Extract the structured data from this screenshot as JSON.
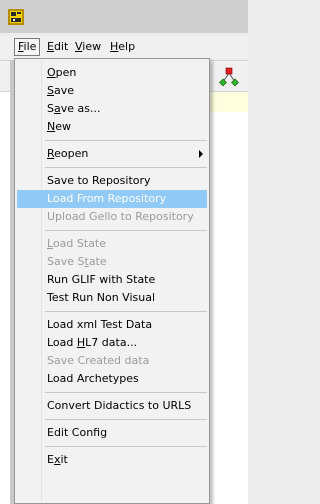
{
  "menubar": {
    "file": "File",
    "edit": "Edit",
    "view": "View",
    "help": "Help"
  },
  "file_menu": {
    "items": [
      {
        "label": "Open",
        "enabled": true
      },
      {
        "label": "Save",
        "enabled": true
      },
      {
        "label": "Save as...",
        "enabled": true
      },
      {
        "label": "New",
        "enabled": true
      },
      {
        "label": "Reopen",
        "enabled": true,
        "submenu": true
      },
      {
        "label": "Save to Repository",
        "enabled": true
      },
      {
        "label": "Load From Repository",
        "enabled": true,
        "highlighted": true
      },
      {
        "label": "Upload Gello to Repository",
        "enabled": false
      },
      {
        "label": "Load State",
        "enabled": false
      },
      {
        "label": "Save State",
        "enabled": false
      },
      {
        "label": "Run GLIF with State",
        "enabled": true
      },
      {
        "label": "Test Run Non Visual",
        "enabled": true
      },
      {
        "label": "Load xml Test Data",
        "enabled": true
      },
      {
        "label": "Load HL7 data...",
        "enabled": true
      },
      {
        "label": "Save Created data",
        "enabled": false
      },
      {
        "label": "Load Archetypes",
        "enabled": true
      },
      {
        "label": "Convert Didactics to URLS",
        "enabled": true
      },
      {
        "label": "Edit Config",
        "enabled": true
      },
      {
        "label": "Exit",
        "enabled": true
      }
    ]
  },
  "colors": {
    "highlight": "#91c9f7",
    "disabled_text": "#9b9b9b",
    "menu_background": "#f2f2f2"
  },
  "icons": {
    "app": "app-icon",
    "toolbar": "network-icon",
    "submenu": "submenu-arrow-icon"
  }
}
